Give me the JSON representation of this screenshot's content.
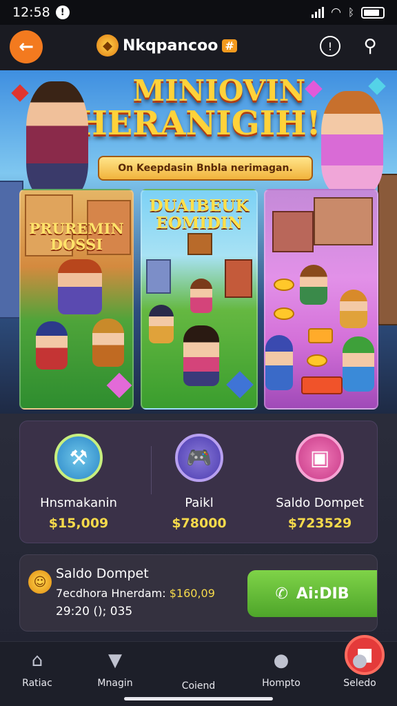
{
  "status": {
    "time": "12:58"
  },
  "appbar": {
    "brand": "Nkqpancoo",
    "brand_badge": "#"
  },
  "hero": {
    "title_line1": "MINIOVIN",
    "title_line2": "HERANIGIH!",
    "banner": "On Keepdasin Bnbla nerimagan.",
    "panel1_title": "PRUREMIN DOSSI",
    "panel2_title": "DUAIBEUK EOMIDIN"
  },
  "stats": [
    {
      "label": "Hnsmakanin",
      "value": "$15,009"
    },
    {
      "label": "Paikl",
      "value": "$78000"
    },
    {
      "label": "Saldo Dompet",
      "value": "$723529"
    }
  ],
  "wallet": {
    "title": "Saldo Dompet",
    "line1_label": "7ecdhora Hnerdam:",
    "line1_value": "$160,09",
    "line2": "29:20 (); 035",
    "button_label": "Ai:DIB"
  },
  "nav": [
    {
      "label": "Ratiac"
    },
    {
      "label": "Mnagin"
    },
    {
      "label": "Coiend"
    },
    {
      "label": "Hompto"
    },
    {
      "label": "Seledo"
    }
  ],
  "colors": {
    "accent_orange": "#f37a1f",
    "value_yellow": "#f6da4b",
    "cta_green": "#5cba32",
    "center_red": "#e43a3a"
  }
}
